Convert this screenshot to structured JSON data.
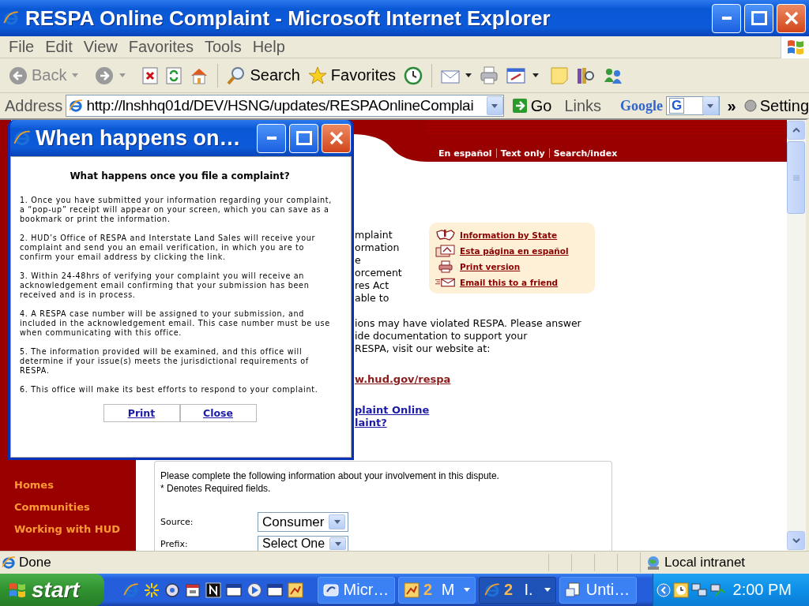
{
  "window": {
    "title": "RESPA Online Complaint - Microsoft Internet Explorer"
  },
  "menu": [
    "File",
    "Edit",
    "View",
    "Favorites",
    "Tools",
    "Help"
  ],
  "toolbar": {
    "back": "Back",
    "search": "Search",
    "favorites": "Favorites"
  },
  "address_bar": {
    "label": "Address",
    "url": "http://lnshhq01d/DEV/HSNG/updates/RESPAOnlineComplai",
    "go": "Go",
    "links": "Links",
    "google": "Google",
    "google_field": "G",
    "more": "»",
    "settings": "Setting"
  },
  "page": {
    "header_links": [
      "En español",
      "Text only",
      "Search/index"
    ],
    "sidebar": [
      "Homes",
      "Communities",
      "Working with HUD"
    ],
    "intro_fragments": [
      "mplaint",
      "ormation",
      "e",
      "orcement",
      "res Act",
      "able to"
    ],
    "tools": [
      {
        "kind": "map",
        "label": "Information by State"
      },
      {
        "kind": "translate",
        "label": "Esta página en español"
      },
      {
        "kind": "print",
        "label": "Print version"
      },
      {
        "kind": "email",
        "label": "Email this to a friend"
      }
    ],
    "body_fragments": [
      "ions may have violated RESPA. Please answer",
      "ide documentation to support your",
      "RESPA, visit our website at:"
    ],
    "respa_link": "w.hud.gov/respa",
    "links": [
      "plaint Online",
      "laint?"
    ],
    "form": {
      "intro": "Please complete the following information about your involvement in this dispute.",
      "required_note": "* Denotes Required fields.",
      "fields": [
        {
          "label": "Source:",
          "value": "Consumer"
        },
        {
          "label": "Prefix:",
          "value": "Select One"
        }
      ]
    }
  },
  "popup": {
    "title": "When happens on…",
    "heading": "What happens once you file a complaint?",
    "items": [
      "1. Once you have submitted your information regarding your complaint, a “pop-up” receipt will appear on your screen, which you can save as a bookmark or print the information.",
      "2. HUD’s Office of RESPA and Interstate Land Sales will receive your complaint and send you an email verification, in which you are to confirm your email address by clicking the link.",
      "3. Within 24-48hrs of verifying your complaint you will receive an acknowledgement email confirming that your submission has been received and is in process.",
      "4. A RESPA case number will be assigned to your submission, and included in the acknowledgement email.  This case number must be use when communicating with this office.",
      "5. The information provided will be examined, and this office will determine if your issue(s) meets the jurisdictional requirements of RESPA.",
      "6. This office will make its best efforts to respond to your complaint."
    ],
    "buttons": [
      "Print",
      "Close"
    ]
  },
  "status_bar": {
    "text": "Done",
    "zone": "Local intranet"
  },
  "taskbar": {
    "start": "start",
    "tasks": [
      {
        "kind": "single",
        "label": "Micr…",
        "selected": false
      },
      {
        "kind": "group",
        "count": "2",
        "label": "M",
        "selected": false
      },
      {
        "kind": "group",
        "count": "2",
        "label": "I.",
        "selected": true
      },
      {
        "kind": "single",
        "label": "Unti…",
        "selected": false
      }
    ],
    "clock": "2:00 PM"
  }
}
